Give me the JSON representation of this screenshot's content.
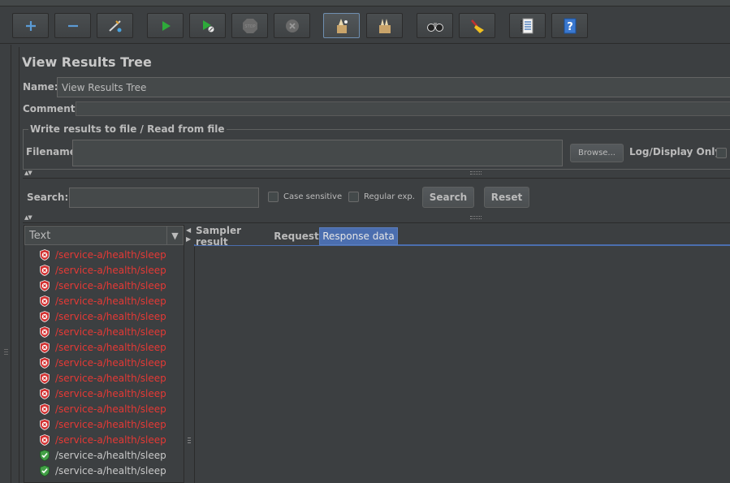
{
  "toolbar": {
    "buttons": [
      {
        "name": "add-icon",
        "glyph": "+"
      },
      {
        "name": "remove-icon",
        "glyph": "−"
      },
      {
        "name": "toggle-icon"
      },
      {
        "name": "start-icon"
      },
      {
        "name": "start-no-pauses-icon"
      },
      {
        "name": "stop-icon"
      },
      {
        "name": "shutdown-icon"
      },
      {
        "name": "clear-icon"
      },
      {
        "name": "clear-all-icon"
      },
      {
        "name": "search-binoculars-icon"
      },
      {
        "name": "reset-search-broom-icon"
      },
      {
        "name": "function-helper-icon"
      },
      {
        "name": "help-icon"
      }
    ]
  },
  "panel": {
    "title": "View Results Tree",
    "name_label": "Name:",
    "name_value": "View Results Tree",
    "comments_label": "Comments:",
    "comments_value": "",
    "file_group_title": "Write results to file / Read from file",
    "filename_label": "Filename",
    "filename_value": "",
    "browse_label": "Browse...",
    "log_display_label": "Log/Display Only:"
  },
  "search": {
    "label": "Search:",
    "value": "",
    "case_sensitive_label": "Case sensitive",
    "regex_label": "Regular exp.",
    "search_button": "Search",
    "reset_button": "Reset"
  },
  "tree": {
    "header": "Text",
    "rows": [
      {
        "text": "/service-a/health/sleep",
        "status": "error"
      },
      {
        "text": "/service-a/health/sleep",
        "status": "error"
      },
      {
        "text": "/service-a/health/sleep",
        "status": "error"
      },
      {
        "text": "/service-a/health/sleep",
        "status": "error"
      },
      {
        "text": "/service-a/health/sleep",
        "status": "error"
      },
      {
        "text": "/service-a/health/sleep",
        "status": "error"
      },
      {
        "text": "/service-a/health/sleep",
        "status": "error"
      },
      {
        "text": "/service-a/health/sleep",
        "status": "error"
      },
      {
        "text": "/service-a/health/sleep",
        "status": "error"
      },
      {
        "text": "/service-a/health/sleep",
        "status": "error"
      },
      {
        "text": "/service-a/health/sleep",
        "status": "error"
      },
      {
        "text": "/service-a/health/sleep",
        "status": "error"
      },
      {
        "text": "/service-a/health/sleep",
        "status": "error"
      },
      {
        "text": "/service-a/health/sleep",
        "status": "success"
      },
      {
        "text": "/service-a/health/sleep",
        "status": "success"
      }
    ]
  },
  "result_tabs": [
    {
      "label": "Sampler result",
      "selected": false
    },
    {
      "label": "Request",
      "selected": false
    },
    {
      "label": "Response data",
      "selected": true
    }
  ],
  "colors": {
    "error_text": "#e53935",
    "success_icon": "#43a047",
    "selected_tab": "#4b6eaf"
  }
}
